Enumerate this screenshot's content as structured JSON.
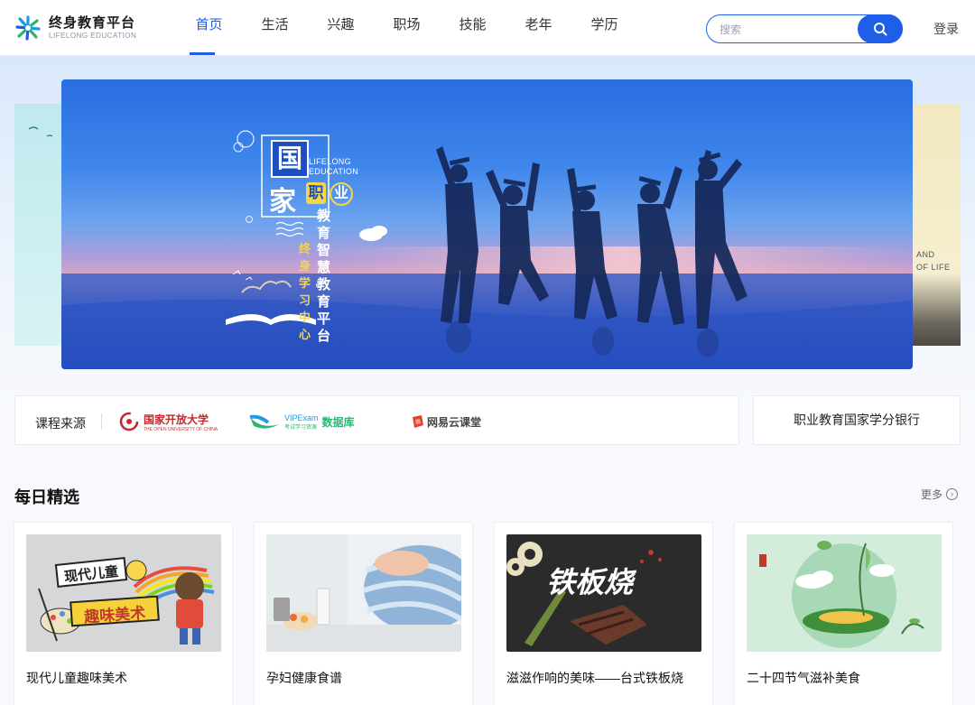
{
  "header": {
    "logo_title": "终身教育平台",
    "logo_sub": "LIFELONG EDUCATION",
    "nav": [
      "首页",
      "生活",
      "兴趣",
      "职场",
      "技能",
      "老年",
      "学历"
    ],
    "active_nav": "首页",
    "search_placeholder": "搜索",
    "login_label": "登录",
    "accent_color": "#1e5ee8"
  },
  "banner": {
    "guo": "国",
    "jia": "家",
    "zhi": "职",
    "ye": "业",
    "en_line1": "LIFELONG",
    "en_line2": "EDUCATION",
    "vertical_main": "教育智慧教育平台",
    "vertical_sub": "终身学习中心",
    "right_peek_line1": "AND",
    "right_peek_line2": "OF LIFE"
  },
  "sources": {
    "label": "课程来源",
    "items": [
      {
        "name": "国家开放大学",
        "sub": "THE OPEN UNIVERSITY OF CHINA"
      },
      {
        "name": "VIPExam",
        "sub": "考试学习资源",
        "name2": "数据库"
      },
      {
        "name": "网易云课堂"
      }
    ],
    "credit_bank": "职业教育国家学分银行"
  },
  "daily": {
    "title": "每日精选",
    "more_label": "更多",
    "cards": [
      {
        "title": "现代儿童趣味美术",
        "img_text1": "现代儿童",
        "img_text2": "趣味美术"
      },
      {
        "title": "孕妇健康食谱"
      },
      {
        "title": "滋滋作响的美味——台式铁板烧",
        "img_text1": "铁板烧"
      },
      {
        "title": "二十四节气滋补美食"
      }
    ]
  }
}
